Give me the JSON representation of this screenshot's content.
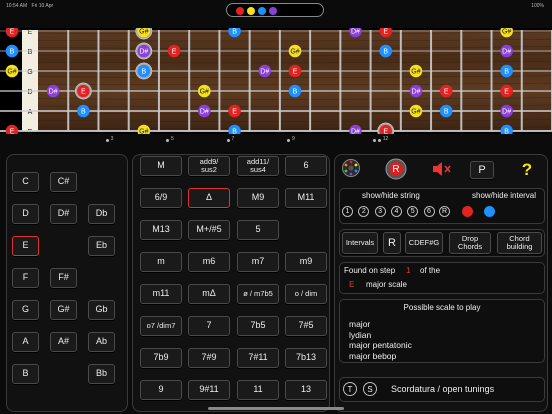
{
  "status": {
    "time": "10:54 AM",
    "date": "Fri 10 Apr",
    "battery": "100%"
  },
  "colors": {
    "red": "#e52222",
    "yellow": "#f5e21c",
    "blue": "#1e90ff",
    "purple": "#8a3fd8",
    "white": "#ffffff"
  },
  "fretboard": {
    "strings": [
      "E",
      "B",
      "G",
      "D",
      "A",
      "E"
    ],
    "fret_labels": [
      "3",
      "5",
      "7",
      "9",
      "12"
    ],
    "notes": [
      {
        "label": "E",
        "color": "red",
        "string": 0,
        "fret": 0
      },
      {
        "label": "B",
        "color": "blue",
        "string": 1,
        "fret": 0
      },
      {
        "label": "G#",
        "color": "yellow",
        "string": 2,
        "fret": 0
      },
      {
        "label": "D#",
        "color": "purple",
        "string": 3,
        "fret": 1
      },
      {
        "label": "B",
        "color": "blue",
        "string": 4,
        "fret": 2
      },
      {
        "label": "E",
        "color": "red",
        "string": 5,
        "fret": 0
      },
      {
        "label": "E",
        "color": "red",
        "string": 1,
        "fret": 5
      },
      {
        "label": "B",
        "color": "blue",
        "string": 0,
        "fret": 7
      },
      {
        "label": "G#",
        "color": "yellow",
        "string": 0,
        "fret": 4,
        "ring": true
      },
      {
        "label": "D#",
        "color": "purple",
        "string": 1,
        "fret": 4,
        "ring": true
      },
      {
        "label": "B",
        "color": "blue",
        "string": 2,
        "fret": 4,
        "ring": true
      },
      {
        "label": "E",
        "color": "red",
        "string": 3,
        "fret": 2,
        "ring": true
      },
      {
        "label": "B",
        "color": "blue",
        "string": 3,
        "fret": 9
      },
      {
        "label": "G#",
        "color": "yellow",
        "string": 3,
        "fret": 6
      },
      {
        "label": "D#",
        "color": "purple",
        "string": 4,
        "fret": 6
      },
      {
        "label": "G#",
        "color": "yellow",
        "string": 5,
        "fret": 4
      },
      {
        "label": "E",
        "color": "red",
        "string": 4,
        "fret": 7
      },
      {
        "label": "B",
        "color": "blue",
        "string": 5,
        "fret": 7
      },
      {
        "label": "D#",
        "color": "purple",
        "string": 5,
        "fret": 11
      },
      {
        "label": "E",
        "color": "red",
        "string": 1,
        "fret": 12
      },
      {
        "label": "G#",
        "color": "yellow",
        "string": 1,
        "fret": 9
      },
      {
        "label": "D#",
        "color": "purple",
        "string": 2,
        "fret": 8
      },
      {
        "label": "E",
        "color": "red",
        "string": 2,
        "fret": 9
      },
      {
        "label": "B",
        "color": "blue",
        "string": 4,
        "fret": 14
      },
      {
        "label": "E",
        "color": "red",
        "string": 5,
        "fret": 12,
        "ring": true
      },
      {
        "label": "D#",
        "color": "purple",
        "string": 0,
        "fret": 11
      },
      {
        "label": "E",
        "color": "red",
        "string": 0,
        "fret": 12
      },
      {
        "label": "B",
        "color": "blue",
        "string": 1,
        "fret": 12
      },
      {
        "label": "G#",
        "color": "yellow",
        "string": 2,
        "fret": 13
      },
      {
        "label": "D#",
        "color": "purple",
        "string": 3,
        "fret": 13
      },
      {
        "label": "E",
        "color": "red",
        "string": 3,
        "fret": 14
      },
      {
        "label": "G#",
        "color": "yellow",
        "string": 4,
        "fret": 13
      },
      {
        "label": "G#",
        "color": "yellow",
        "string": 0,
        "fret": 16
      },
      {
        "label": "D#",
        "color": "purple",
        "string": 1,
        "fret": 16
      },
      {
        "label": "B",
        "color": "blue",
        "string": 2,
        "fret": 16
      },
      {
        "label": "E",
        "color": "red",
        "string": 3,
        "fret": 16
      },
      {
        "label": "B",
        "color": "blue",
        "string": 5,
        "fret": 16
      },
      {
        "label": "D#",
        "color": "purple",
        "string": 4,
        "fret": 16
      }
    ]
  },
  "roots": {
    "items": [
      {
        "label": "C"
      },
      {
        "label": "C#"
      },
      {
        "label": "D"
      },
      {
        "label": "D#"
      },
      {
        "label": "Db"
      },
      {
        "label": "E",
        "selected": true
      },
      {
        "label": "Eb"
      },
      {
        "label": "F"
      },
      {
        "label": "F#"
      },
      {
        "label": "G"
      },
      {
        "label": "G#"
      },
      {
        "label": "Gb"
      },
      {
        "label": "A"
      },
      {
        "label": "A#"
      },
      {
        "label": "Ab"
      },
      {
        "label": "B"
      },
      {
        "label": "Bb"
      }
    ]
  },
  "chords": {
    "items": [
      "M",
      "add9/\nsus2",
      "add11/\nsus4",
      "6",
      "6/9",
      "Δ",
      "M9",
      "M11",
      "M13",
      "M+/#5",
      "5",
      "",
      "m",
      "m6",
      "m7",
      "m9",
      "m11",
      "mΔ",
      "ø / m7b5",
      "o / dim",
      "o7 /dim7",
      "7",
      "7b5",
      "7#5",
      "7b9",
      "7#9",
      "7#11",
      "7b13",
      "9",
      "9#11",
      "11",
      "13"
    ],
    "selected_index": 5
  },
  "tools": {
    "root_label": "R",
    "pattern_label": "P",
    "help_label": "?"
  },
  "show_hide": {
    "string_label": "show/hide string",
    "interval_label": "show/hide interval",
    "string_numbers": [
      "1",
      "2",
      "3",
      "4",
      "5",
      "6"
    ],
    "root_toggle": "R"
  },
  "modes": {
    "intervals": "Intervals",
    "root": "R",
    "cdefg": "CDEF#G",
    "drop": "Drop\nChords",
    "building": "Chord\nbuilding"
  },
  "found": {
    "prefix": "Found on step",
    "step": "1",
    "of_the": "of the",
    "note": "E",
    "scale": "major scale"
  },
  "possible": {
    "title": "Possible scale to play",
    "scales": [
      "major",
      "lydian",
      "major pentatonic",
      "major bebop"
    ]
  },
  "bottom": {
    "t_label": "T",
    "s_label": "S",
    "text": "Scordatura / open tunings"
  }
}
